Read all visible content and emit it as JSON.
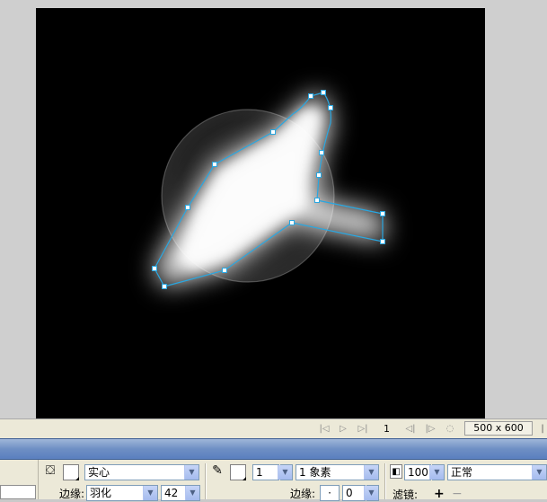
{
  "frame_bar": {
    "frame_number": "1",
    "doc_size": "500 x 600"
  },
  "properties": {
    "fill": {
      "color": "#ffffff",
      "style": "实心",
      "edge_label": "边缘:",
      "edge_mode": "羽化",
      "feather_amount": "42"
    },
    "stroke": {
      "color": "#ffffff",
      "width": "1",
      "style": "1 象素",
      "edge_label": "边缘:",
      "edge_value": "0"
    },
    "layer": {
      "opacity": "100",
      "blend_mode": "正常",
      "filters_label": "滤镜:",
      "add": "+",
      "remove": "−"
    }
  },
  "colors": {
    "stage_bg": "#000000",
    "path_color": "#29a7e1",
    "panel_title": "#6e8fc4"
  }
}
